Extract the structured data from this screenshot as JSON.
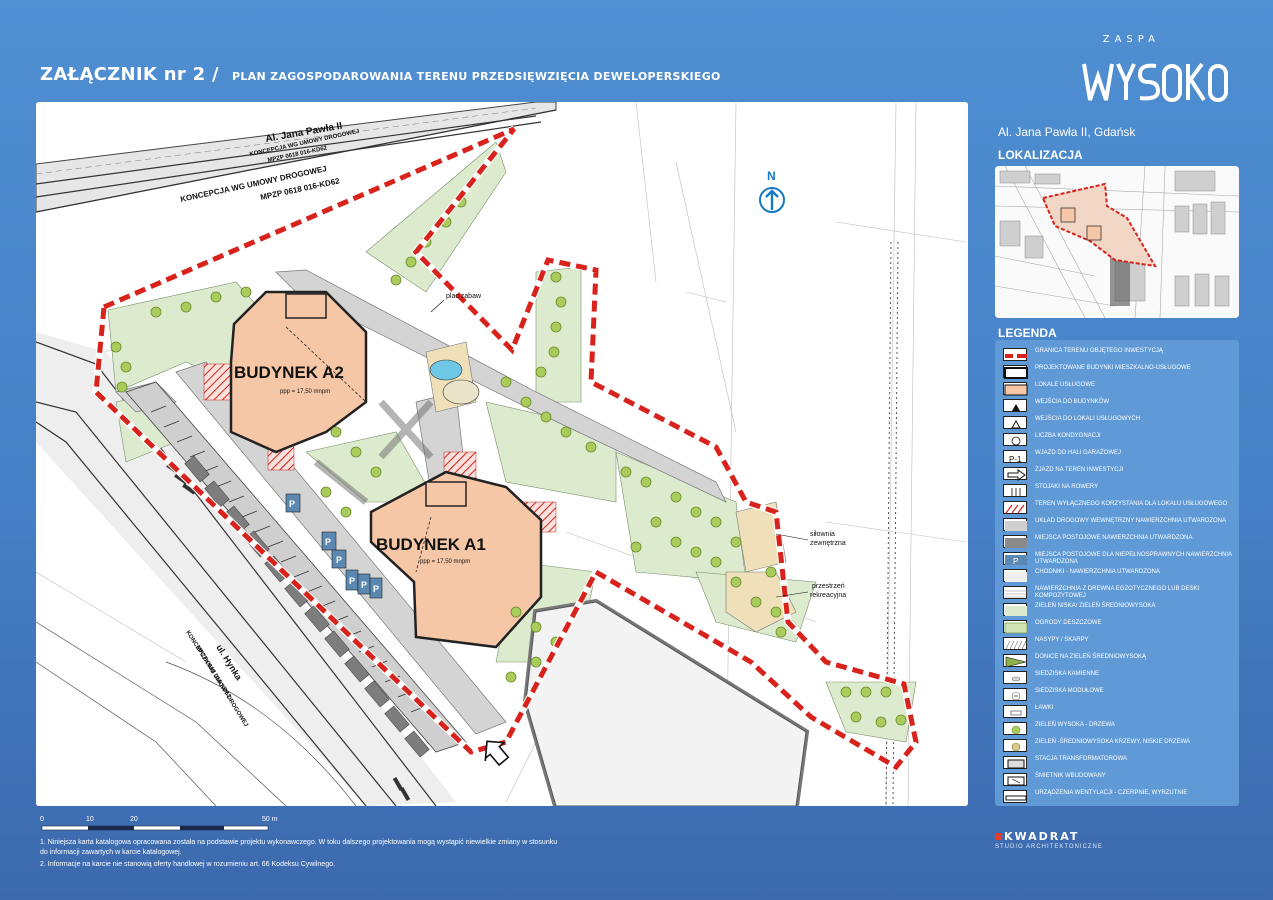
{
  "header": {
    "title": "ZAŁĄCZNIK nr 2 /",
    "subtitle": "PLAN ZAGOSPODAROWANIA TERENU PRZEDSIĘWZIĘCIA DEWELOPERSKIEGO"
  },
  "logo": {
    "top": "ZASPA",
    "main": "WYSOKO"
  },
  "address": "Al. Jana Pawła II, Gdańsk",
  "sections": {
    "location": "LOKALIZACJA",
    "legend": "LEGENDA"
  },
  "map": {
    "street_top": "Al. Jana Pawła II",
    "concept_small_1": "KONCEPCJA WG UMOWY DROGOWEJ",
    "concept_small_2": "MPZP 0618 016-KD62",
    "concept_big_1": "KONCEPCJA WG UMOWY DROGOWEJ",
    "concept_big_2": "MPZP 0618 016-KD62",
    "north": "N",
    "building_a2": "BUDYNEK A2",
    "building_a1": "BUDYNEK A1",
    "ppp_a2": "ppp = 17,50 mnpm",
    "ppp_a1": "ppp = 17,50 mnpm",
    "playground": "plac zabaw",
    "gym_1": "siłownia",
    "gym_2": "zewnętrzna",
    "recreation_1": "przestrzeń",
    "recreation_2": "rekreacyjna",
    "street_hynka": "ul. Hynka",
    "concept_side_1": "KONCEPCJA WG UMOWY DROGOWEJ",
    "concept_side_2": "MPZP 0618 016-KD62",
    "parking_p": "P"
  },
  "legend": [
    {
      "label": "GRANICA TERENU OBJĘTEGO INWESTYCJĄ",
      "sym": "boundary"
    },
    {
      "label": "PROJEKTOWANE BUDYNKI MIESZKALNO-USŁUGOWE",
      "sym": "building"
    },
    {
      "label": "LOKALE USŁUGOWE",
      "sym": "service"
    },
    {
      "label": "WEJŚCIA DO BUDYNKÓW",
      "sym": "entry"
    },
    {
      "label": "WEJŚCIA DO LOKALI USŁUGOWYCH",
      "sym": "entry-service"
    },
    {
      "label": "LICZBA KONDYGNACJI",
      "sym": "floors"
    },
    {
      "label": "WJAZD DO HALI GARAŻOWEJ",
      "sym": "garage"
    },
    {
      "label": "ZJAZD NA TEREN INWESTYCJI",
      "sym": "arrow"
    },
    {
      "label": "STOJAKI NA ROWERY",
      "sym": "bikes"
    },
    {
      "label": "TEREN WYŁĄCZNEGO KORZYSTANIA DLA LOKALU USŁUGOWEGO",
      "sym": "hatch-red"
    },
    {
      "label": "UKŁAD DROGOWY WEWNĘTRZNY NAWIERZCHNIA UTWARDZONA",
      "sym": "road"
    },
    {
      "label": "MIEJSCA POSTOJOWE NAWIERZCHNIA UTWARDZONA",
      "sym": "parking"
    },
    {
      "label": "MIEJSCA POSTOJOWE DLA NIEPEŁNOSPRAWNYCH NAWIERZCHNIA UTWARDZONA",
      "sym": "parking-dis"
    },
    {
      "label": "CHODNIKI - NAWIERZCHNIA UTWARDZONA",
      "sym": "sidewalk"
    },
    {
      "label": "NAWIERZCHNIA Z DREWNA EGZOTYCZNEGO LUB DESKI KOMPOZYTOWEJ",
      "sym": "wood"
    },
    {
      "label": "ZIELEŃ NISKA/ ZIELEŃ ŚREDNIOWYSOKA",
      "sym": "green-low"
    },
    {
      "label": "OGRODY DESZCZOWE",
      "sym": "rain-garden"
    },
    {
      "label": "NASYPY / SKARPY",
      "sym": "slope"
    },
    {
      "label": "DONICE NA ZIELEŃ ŚREDNIOWYSOKĄ",
      "sym": "planter"
    },
    {
      "label": "SIEDZISKA KAMIENNE",
      "sym": "stone-seat"
    },
    {
      "label": "SIEDZISKA MODUŁOWE",
      "sym": "module-seat"
    },
    {
      "label": "ŁAWKI",
      "sym": "bench"
    },
    {
      "label": "ZIELEŃ WYSOKA - DRZEWA",
      "sym": "tree"
    },
    {
      "label": "ZIELEŃ -ŚREDNIOWYSOKA KRZEWY, NISKIE DRZEWA",
      "sym": "shrub"
    },
    {
      "label": "STACJA TRANSFORMATOROWA",
      "sym": "transformer"
    },
    {
      "label": "ŚMIETNIK WBUDOWANY",
      "sym": "bin"
    },
    {
      "label": "URZĄDZENIA WENTYLACJI - CZERPNIE, WYRZUTNIE",
      "sym": "vent"
    }
  ],
  "scale": {
    "labels": [
      "0",
      "10",
      "20",
      "50 m"
    ],
    "ticks_m": [
      0,
      10,
      20,
      50
    ]
  },
  "notes": [
    "1. Niniejsza karta katalogowa opracowana została na podstawie projektu wykonawczego. W toku dalszego projektowania mogą wystąpić niewielkie zmiany w stosunku",
    "do informacji zawartych w karcie katalogowej.",
    "2. Informacje na karcie nie stanowią oferty handlowej w rozumieniu art. 66 Kodeksu Cywilnego."
  ],
  "company": {
    "name": "KWADRAT",
    "sub": "STUDIO ARCHITEKTONICZNE"
  },
  "colors": {
    "boundary": "#d8221c",
    "green": "#d9ebc9",
    "tree": "#a9cc5c",
    "building": "#f6c7a6",
    "parking": "#5a88b0"
  }
}
